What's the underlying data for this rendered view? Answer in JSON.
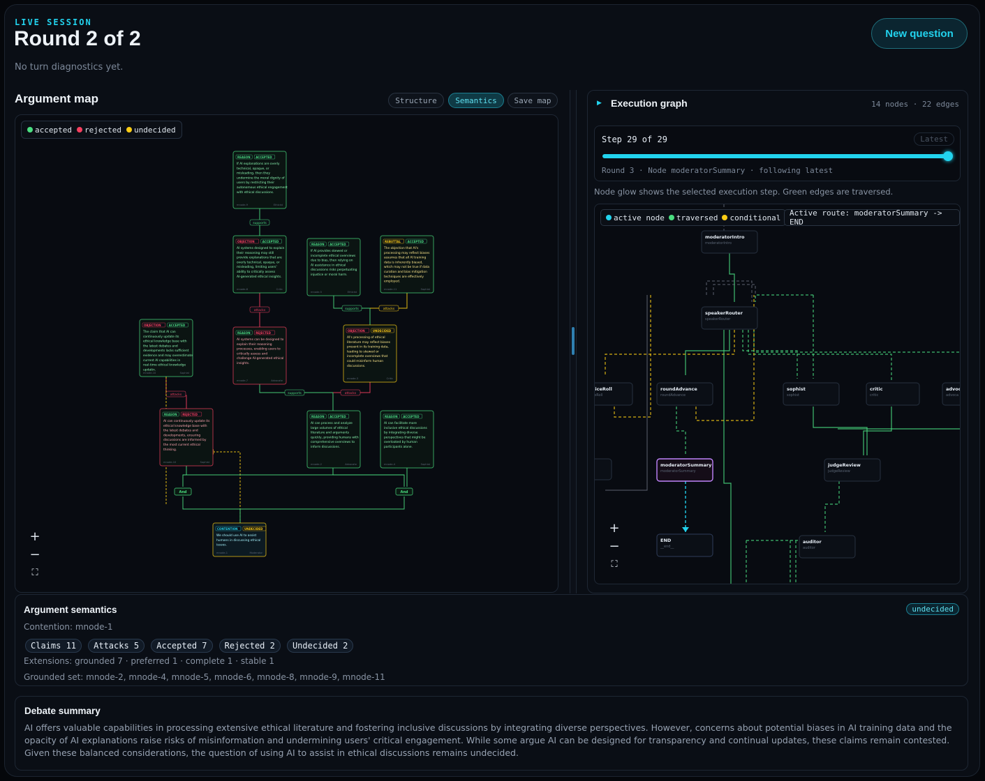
{
  "header": {
    "eyebrow": "LIVE SESSION",
    "title": "Round 2 of 2",
    "diagnostics": "No turn diagnostics yet.",
    "new_question_label": "New question"
  },
  "argument_map": {
    "title": "Argument map",
    "tabs": [
      {
        "label": "Structure",
        "active": false
      },
      {
        "label": "Semantics",
        "active": true
      },
      {
        "label": "Save map",
        "active": false
      }
    ],
    "legend": {
      "accepted": "accepted",
      "rejected": "rejected",
      "undecided": "undecided"
    },
    "colors": {
      "accepted": "#4ade80",
      "rejected": "#f43f5e",
      "undecided": "#facc15",
      "contention": "#22d3ee"
    },
    "edge_labels": {
      "supports": "supports",
      "attacks": "attacks",
      "undercuts": "undercuts",
      "and": "And"
    },
    "nodes": [
      {
        "id": "mnode-9",
        "kind": "REASON",
        "status": "ACCEPTED",
        "agent": "Ethicist",
        "text": "If AI explanations are overly technical, opaque, or misleading, then they undermine the moral dignity of users by restricting their autonomous ethical engagement with ethical discussions."
      },
      {
        "id": "mnode-8",
        "kind": "OBJECTION",
        "status": "ACCEPTED",
        "agent": "Critic",
        "text": "AI systems designed to explain their reasoning may still provide explanations that are overly technical, opaque, or misleading, limiting users' ability to critically assess AI-generated ethical insights."
      },
      {
        "id": "mnode-5",
        "kind": "REASON",
        "status": "ACCEPTED",
        "agent": "Ethicist",
        "text": "If AI provides skewed or incomplete ethical overviews due to bias, then relying on AI assistance in ethical discussions risks perpetuating injustice or moral harm."
      },
      {
        "id": "mnode-11",
        "kind": "REBUTTAL",
        "status": "ACCEPTED",
        "agent": "Sophist",
        "text": "The objection that AI's processing may reflect biases assumes that all AI training data is inherently biased, which may not be true if data curation and bias mitigation techniques are effectively employed."
      },
      {
        "id": "mnode-10",
        "kind": "OBJECTION",
        "status": "ACCEPTED",
        "agent": "Sophist",
        "text": "The claim that AI can continuously update its ethical knowledge base with the latest debates and developments lacks sufficient evidence and may overestimate current AI capabilities in real-time ethical knowledge updatin."
      },
      {
        "id": "mnode-7",
        "kind": "REASON",
        "status": "REJECTED",
        "agent": "Advocate",
        "text": "AI systems can be designed to explain their reasoning processes, enabling users to critically assess and challenge AI-generated ethical insights."
      },
      {
        "id": "mnode-3",
        "kind": "OBJECTION",
        "status": "UNDECIDED",
        "agent": "Critic",
        "text": "AI's processing of ethical literature may reflect biases present in its training data, leading to skewed or incomplete overviews that could misinform human discussions."
      },
      {
        "id": "mnode-10b",
        "kind": "REASON",
        "status": "REJECTED",
        "agent": "Sophist",
        "text": "AI can continuously update its ethical knowledge base with the latest debates and developments, ensuring discussions are informed by the most current ethical thinking."
      },
      {
        "id": "mnode-2",
        "kind": "REASON",
        "status": "ACCEPTED",
        "agent": "Advocate",
        "text": "AI can process and analyze large volumes of ethical literature and arguments quickly, providing humans with comprehensive overviews to inform discussions."
      },
      {
        "id": "mnode-4",
        "kind": "REASON",
        "status": "ACCEPTED",
        "agent": "Sophist",
        "text": "AI can facilitate more inclusive ethical discussions by integrating diverse perspectives that might be overlooked by human participants alone."
      },
      {
        "id": "mnode-1",
        "kind": "CONTENTION",
        "status": "UNDECIDED",
        "agent": "Moderator",
        "text": "We should use AI to assist humans in discussing ethical issues."
      }
    ]
  },
  "execution_graph": {
    "title": "Execution graph",
    "counts": "14 nodes · 22 edges",
    "step_label": "Step 29 of 29",
    "latest_label": "Latest",
    "step_progress": 1.0,
    "step_meta": "Round 3 · Node moderatorSummary · following latest",
    "hint": "Node glow shows the selected execution step. Green edges are traversed.",
    "legend": {
      "active": "active node",
      "traversed": "traversed",
      "conditional": "conditional"
    },
    "active_route": "Active route: moderatorSummary -> END",
    "colors": {
      "active": "#22d3ee",
      "traversed": "#4ade80",
      "conditional": "#facc15"
    },
    "nodes": [
      {
        "title": "moderatorIntro",
        "sub": "moderatorIntro"
      },
      {
        "title": "speakerRouter",
        "sub": "speakerRouter"
      },
      {
        "title": "DiceRoll",
        "sub": "iceRoll"
      },
      {
        "title": "roundAdvance",
        "sub": "roundAdvance"
      },
      {
        "title": "sophist",
        "sub": "sophist"
      },
      {
        "title": "critic",
        "sub": "critic"
      },
      {
        "title": "advoc",
        "sub": "advoca"
      },
      {
        "title": "moderatorSummary",
        "sub": "moderatorSummary"
      },
      {
        "title": "judgeReview",
        "sub": "judgeReview"
      },
      {
        "title": "END",
        "sub": "__end__"
      },
      {
        "title": "auditor",
        "sub": "auditor"
      }
    ]
  },
  "semantics": {
    "title": "Argument semantics",
    "status_badge": "undecided",
    "contention": "Contention: mnode-1",
    "pills": [
      "Claims 11",
      "Attacks 5",
      "Accepted 7",
      "Rejected 2",
      "Undecided 2"
    ],
    "extensions": "Extensions: grounded 7 · preferred 1 · complete 1 · stable 1",
    "grounded_set": "Grounded set: mnode-2, mnode-4, mnode-5, mnode-6, mnode-8, mnode-9, mnode-11"
  },
  "summary": {
    "title": "Debate summary",
    "text": "AI offers valuable capabilities in processing extensive ethical literature and fostering inclusive discussions by integrating diverse perspectives. However, concerns about potential biases in AI training data and the opacity of AI explanations raise risks of misinformation and undermining users' critical engagement. While some argue AI can be designed for transparency and continual updates, these claims remain contested. Given these balanced considerations, the question of using AI to assist in ethical discussions remains undecided."
  }
}
